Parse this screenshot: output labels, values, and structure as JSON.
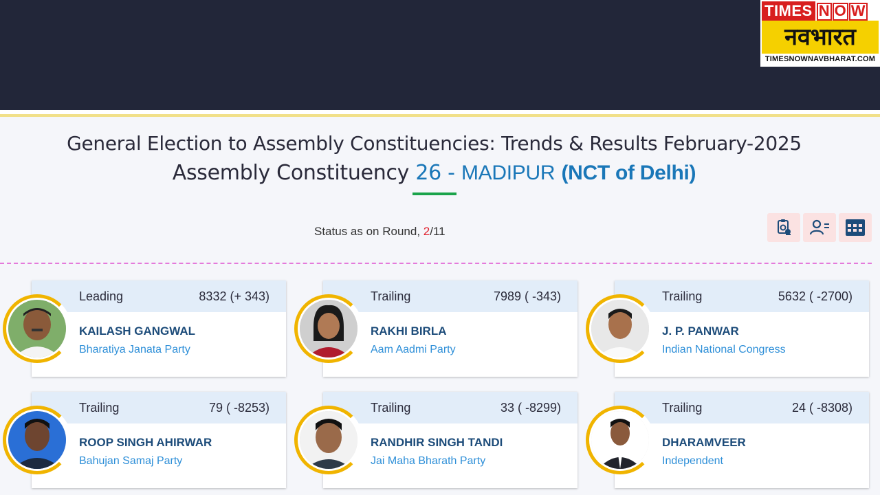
{
  "logo": {
    "times": "TIMES",
    "now": [
      "N",
      "O",
      "W"
    ],
    "hindi": "नवभारत",
    "url": "TIMESNOWNAVBHARAT.COM"
  },
  "heading": {
    "line1": "General Election to Assembly Constituencies: Trends & Results February-2025",
    "prefix": "Assembly Constituency",
    "ac_number": "26 -",
    "ac_name": "MADIPUR",
    "state": "(NCT of Delhi)"
  },
  "status": {
    "label": "Status as on Round,",
    "current_round": "2",
    "total_rounds": "/11"
  },
  "toolbar_icons": [
    "report-icon",
    "candidate-list-icon",
    "table-grid-icon"
  ],
  "colors": {
    "header_bg": "#222639",
    "accent_blue": "#1a77b8",
    "party_blue": "#2e8fd8",
    "name_navy": "#1d4c7a",
    "round_red": "#e0212e",
    "ring_gold": "#f0b400"
  },
  "candidates": [
    {
      "status": "Leading",
      "votes": "8332 (+ 343)",
      "name": "KAILASH GANGWAL",
      "party": "Bharatiya Janata Party"
    },
    {
      "status": "Trailing",
      "votes": "7989 ( -343)",
      "name": "RAKHI BIRLA",
      "party": "Aam Aadmi Party"
    },
    {
      "status": "Trailing",
      "votes": "5632 ( -2700)",
      "name": "J. P. PANWAR",
      "party": "Indian National Congress"
    },
    {
      "status": "Trailing",
      "votes": "79 ( -8253)",
      "name": "ROOP SINGH AHIRWAR",
      "party": "Bahujan Samaj Party"
    },
    {
      "status": "Trailing",
      "votes": "33 ( -8299)",
      "name": "RANDHIR SINGH TANDI",
      "party": "Jai Maha Bharath Party"
    },
    {
      "status": "Trailing",
      "votes": "24 ( -8308)",
      "name": "DHARAMVEER",
      "party": "Independent"
    }
  ]
}
